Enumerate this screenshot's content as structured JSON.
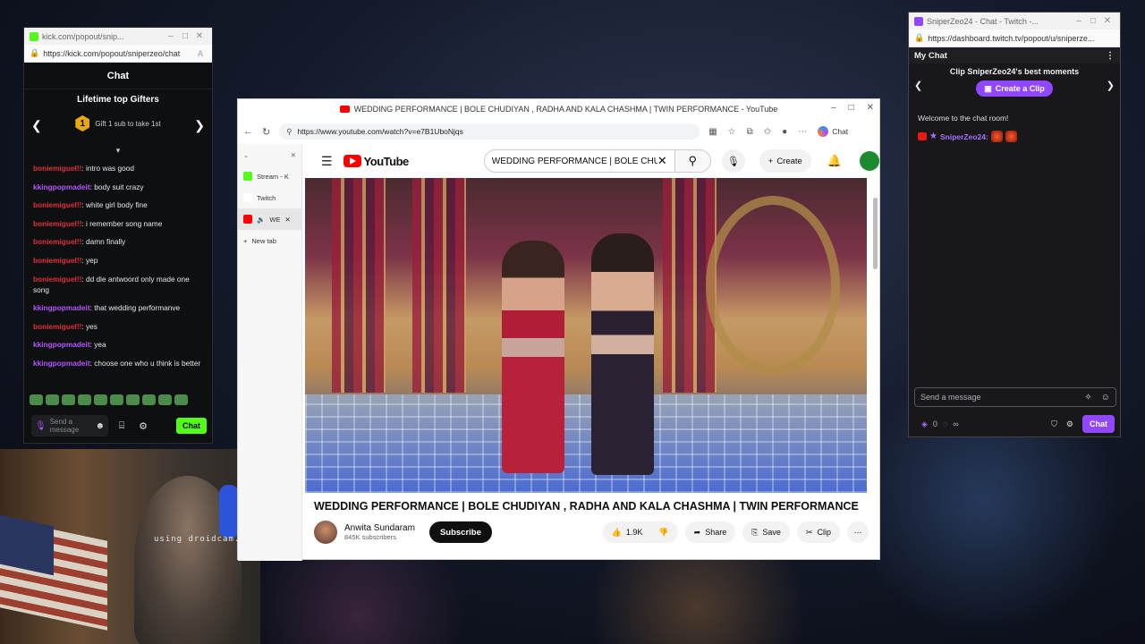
{
  "kick": {
    "window_title": "kick.com/popout/snip...",
    "url": "https://kick.com/popout/sniperzeo/chat",
    "header": "Chat",
    "gifters_title": "Lifetime top Gifters",
    "gifter_rank": "1",
    "gifter_text": "Gift 1 sub to take 1st",
    "messages": [
      {
        "user": "boniemiguel!!",
        "text": ": intro was good",
        "color": "red"
      },
      {
        "user": "kkingpopmadeit",
        "text": ": body suit crazy",
        "color": "purple"
      },
      {
        "user": "boniemiguel!!",
        "text": ": white girl body fine",
        "color": "red"
      },
      {
        "user": "boniemiguel!!",
        "text": ": i remember song name",
        "color": "red"
      },
      {
        "user": "boniemiguel!!",
        "text": ": damn finally",
        "color": "red"
      },
      {
        "user": "boniemiguel!!",
        "text": ": yep",
        "color": "red"
      },
      {
        "user": "boniemiguel!!",
        "text": ": dd die antwoord only made one song",
        "color": "red"
      },
      {
        "user": "kkingpopmadeit",
        "text": ": that wedding performanve",
        "color": "purple"
      },
      {
        "user": "boniemiguel!!",
        "text": ": yes",
        "color": "red"
      },
      {
        "user": "kkingpopmadeit",
        "text": ": yea",
        "color": "purple"
      },
      {
        "user": "kkingpopmadeit",
        "text": ": choose one who u think is better",
        "color": "purple"
      }
    ],
    "input_placeholder": "Send a message",
    "chat_button": "Chat"
  },
  "webcam": {
    "watermark": "using droidcam.ap"
  },
  "youtube": {
    "window_title": "WEDDING PERFORMANCE | BOLE CHUDIYAN , RADHA AND KALA CHASHMA | TWIN PERFORMANCE - YouTube",
    "url": "https://www.youtube.com/watch?v=e7B1UboNjqs",
    "copilot_label": "Chat",
    "tabs": [
      {
        "label": "Stream - K"
      },
      {
        "label": "Twitch"
      },
      {
        "label": "WE"
      },
      {
        "label": "New tab"
      }
    ],
    "logo_text": "YouTube",
    "search_query": "WEDDING PERFORMANCE | BOLE CHU",
    "create_label": "Create",
    "video_title": "WEDDING PERFORMANCE | BOLE CHUDIYAN , RADHA AND KALA CHASHMA | TWIN PERFORMANCE",
    "channel_name": "Anwita Sundaram",
    "channel_subs": "845K subscribers",
    "subscribe_label": "Subscribe",
    "like_count": "1.9K",
    "share_label": "Share",
    "save_label": "Save",
    "clip_label": "Clip"
  },
  "twitch": {
    "window_title": "SniperZeo24 - Chat - Twitch -...",
    "url": "https://dashboard.twitch.tv/popout/u/sniperze...",
    "header": "My Chat",
    "clip_title": "Clip SniperZeo24's best moments",
    "create_clip": "Create a Clip",
    "welcome": "Welcome to the chat room!",
    "user": "SniperZeo24:",
    "input_placeholder": "Send a message",
    "points": "0",
    "infinity": "∞",
    "chat_button": "Chat"
  },
  "colors": {
    "kick_green": "#53fc18",
    "twitch_purple": "#9147ff",
    "youtube_red": "#ff0000"
  }
}
